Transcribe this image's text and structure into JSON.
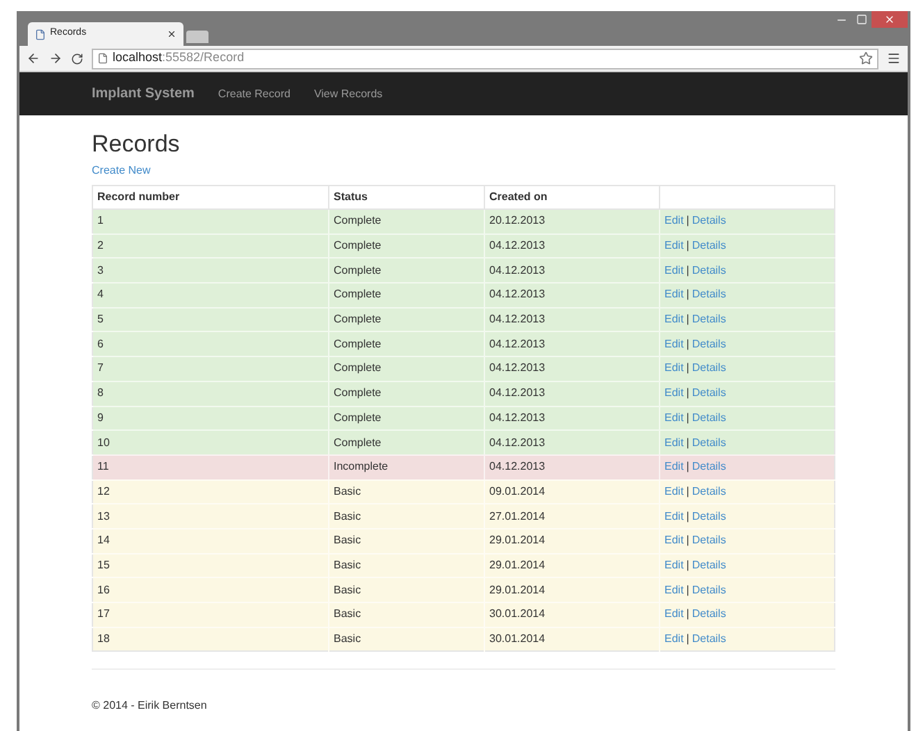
{
  "browser": {
    "tab": {
      "title": "Records"
    },
    "address": {
      "host": "localhost",
      "rest": ":55582/Record"
    }
  },
  "navbar": {
    "brand": "Implant System",
    "links": [
      "Create Record",
      "View Records"
    ]
  },
  "page": {
    "heading": "Records",
    "create_link": "Create New"
  },
  "table": {
    "columns": [
      "Record number",
      "Status",
      "Created on"
    ],
    "rows": [
      {
        "kind": "complete",
        "number": "1",
        "status": "Complete",
        "created": "20.12.2013",
        "edit": "Edit",
        "sep": "|",
        "details": "Details"
      },
      {
        "kind": "complete",
        "number": "2",
        "status": "Complete",
        "created": "04.12.2013",
        "edit": "Edit",
        "sep": "|",
        "details": "Details"
      },
      {
        "kind": "complete",
        "number": "3",
        "status": "Complete",
        "created": "04.12.2013",
        "edit": "Edit",
        "sep": "|",
        "details": "Details"
      },
      {
        "kind": "complete",
        "number": "4",
        "status": "Complete",
        "created": "04.12.2013",
        "edit": "Edit",
        "sep": "|",
        "details": "Details"
      },
      {
        "kind": "complete",
        "number": "5",
        "status": "Complete",
        "created": "04.12.2013",
        "edit": "Edit",
        "sep": "|",
        "details": "Details"
      },
      {
        "kind": "complete",
        "number": "6",
        "status": "Complete",
        "created": "04.12.2013",
        "edit": "Edit",
        "sep": "|",
        "details": "Details"
      },
      {
        "kind": "complete",
        "number": "7",
        "status": "Complete",
        "created": "04.12.2013",
        "edit": "Edit",
        "sep": "|",
        "details": "Details"
      },
      {
        "kind": "complete",
        "number": "8",
        "status": "Complete",
        "created": "04.12.2013",
        "edit": "Edit",
        "sep": "|",
        "details": "Details"
      },
      {
        "kind": "complete",
        "number": "9",
        "status": "Complete",
        "created": "04.12.2013",
        "edit": "Edit",
        "sep": "|",
        "details": "Details"
      },
      {
        "kind": "complete",
        "number": "10",
        "status": "Complete",
        "created": "04.12.2013",
        "edit": "Edit",
        "sep": "|",
        "details": "Details"
      },
      {
        "kind": "incomplete",
        "number": "11",
        "status": "Incomplete",
        "created": "04.12.2013",
        "edit": "Edit",
        "sep": "|",
        "details": "Details"
      },
      {
        "kind": "basic",
        "number": "12",
        "status": "Basic",
        "created": "09.01.2014",
        "edit": "Edit",
        "sep": "|",
        "details": "Details"
      },
      {
        "kind": "basic",
        "number": "13",
        "status": "Basic",
        "created": "27.01.2014",
        "edit": "Edit",
        "sep": "|",
        "details": "Details"
      },
      {
        "kind": "basic",
        "number": "14",
        "status": "Basic",
        "created": "29.01.2014",
        "edit": "Edit",
        "sep": "|",
        "details": "Details"
      },
      {
        "kind": "basic",
        "number": "15",
        "status": "Basic",
        "created": "29.01.2014",
        "edit": "Edit",
        "sep": "|",
        "details": "Details"
      },
      {
        "kind": "basic",
        "number": "16",
        "status": "Basic",
        "created": "29.01.2014",
        "edit": "Edit",
        "sep": "|",
        "details": "Details"
      },
      {
        "kind": "basic",
        "number": "17",
        "status": "Basic",
        "created": "30.01.2014",
        "edit": "Edit",
        "sep": "|",
        "details": "Details"
      },
      {
        "kind": "basic",
        "number": "18",
        "status": "Basic",
        "created": "30.01.2014",
        "edit": "Edit",
        "sep": "|",
        "details": "Details"
      }
    ]
  },
  "footer": "© 2014 - Eirik Berntsen"
}
